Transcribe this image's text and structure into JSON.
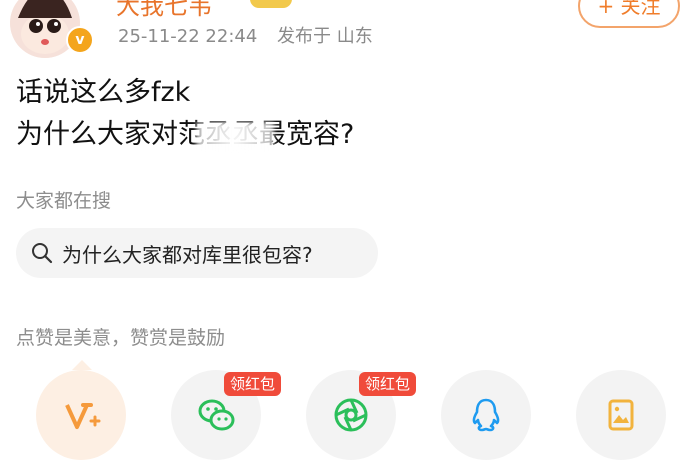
{
  "header": {
    "username": "大我七韦",
    "avatar_badge": "v",
    "date": "25-11-22 22:44",
    "location": "发布于 山东",
    "follow_label": "+ 关注"
  },
  "post": {
    "line1": "话说这么多fzk",
    "line2": "为什么大家对范丞丞最宽容?"
  },
  "search": {
    "title": "大家都在搜",
    "query": "为什么大家都对库里很包容?"
  },
  "reward": {
    "text": "点赞是美意，赞赏是鼓励"
  },
  "share": {
    "tag_label": "领红包",
    "items": [
      {
        "icon": "reward-v-icon"
      },
      {
        "icon": "wechat-icon"
      },
      {
        "icon": "moments-icon"
      },
      {
        "icon": "qq-icon"
      },
      {
        "icon": "album-icon"
      }
    ]
  },
  "colors": {
    "accent": "#f07d2b",
    "wechat": "#2bbf5a",
    "qq": "#1e9bf0",
    "tag": "#f04b3a"
  }
}
